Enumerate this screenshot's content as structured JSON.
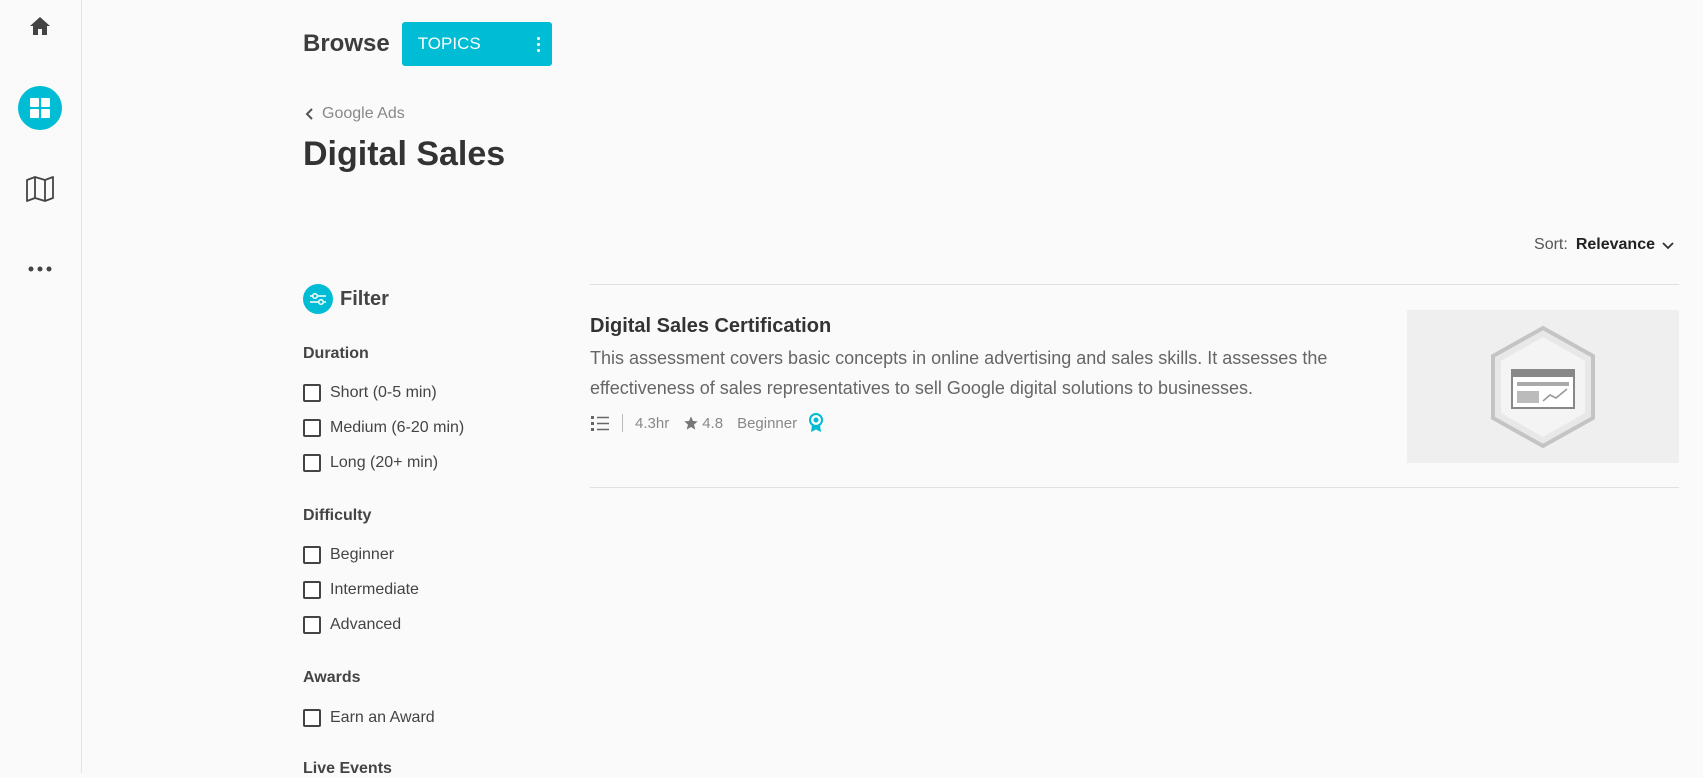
{
  "nav": {
    "items": [
      {
        "icon": "home-icon",
        "active": false
      },
      {
        "icon": "dashboard-icon",
        "active": true
      },
      {
        "icon": "map-icon",
        "active": false
      },
      {
        "icon": "more-icon",
        "active": false
      }
    ]
  },
  "header": {
    "browse_label": "Browse",
    "topics_button": "TOPICS"
  },
  "breadcrumb": {
    "parent": "Google Ads"
  },
  "page": {
    "title": "Digital Sales"
  },
  "sort": {
    "label": "Sort:",
    "value": "Relevance"
  },
  "filter": {
    "title": "Filter",
    "groups": [
      {
        "title": "Duration",
        "options": [
          "Short (0-5 min)",
          "Medium (6-20 min)",
          "Long (20+ min)"
        ]
      },
      {
        "title": "Difficulty",
        "options": [
          "Beginner",
          "Intermediate",
          "Advanced"
        ]
      },
      {
        "title": "Awards",
        "options": [
          "Earn an Award"
        ]
      },
      {
        "title": "Live Events",
        "options": []
      }
    ]
  },
  "results": [
    {
      "title": "Digital Sales Certification",
      "description": "This assessment covers basic concepts in online advertising and sales skills. It assesses the effectiveness of sales representatives to sell Google digital solutions to businesses.",
      "duration": "4.3hr",
      "rating": "4.8",
      "level": "Beginner"
    }
  ],
  "colors": {
    "accent": "#00bcd4",
    "text": "#333333",
    "muted": "#888888"
  }
}
